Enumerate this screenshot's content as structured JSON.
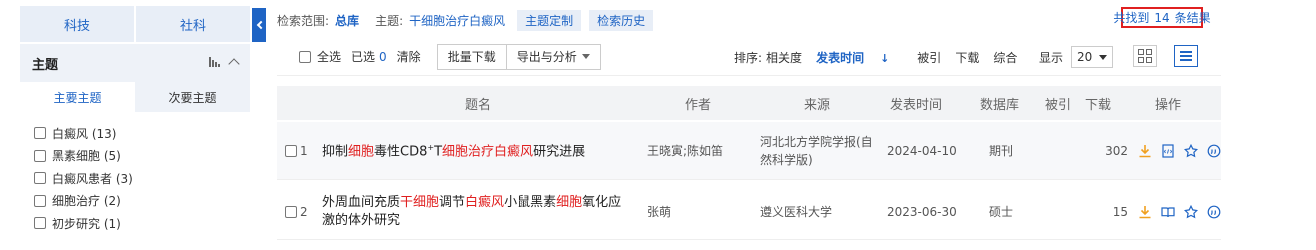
{
  "sidebar": {
    "category_tabs": [
      "科技",
      "社科"
    ],
    "topic_title": "主题",
    "sub_tabs": [
      "主要主题",
      "次要主题"
    ],
    "facets": [
      {
        "label": "白癜风 (13)"
      },
      {
        "label": "黑素细胞 (5)"
      },
      {
        "label": "白癜风患者 (3)"
      },
      {
        "label": "细胞治疗 (2)"
      },
      {
        "label": "初步研究 (1)"
      }
    ]
  },
  "scope": {
    "range_label": "检索范围:",
    "range_value": "总库",
    "topic_label": "主题:",
    "topic_value": "干细胞治疗白癜风",
    "chip_custom": "主题定制",
    "chip_history": "检索历史"
  },
  "result": {
    "prefix": "共找到",
    "count": "14",
    "suffix": "条结果"
  },
  "toolbar": {
    "select_all": "全选",
    "selected_label": "已选",
    "selected_count": "0",
    "clear": "清除",
    "batch_download": "批量下载",
    "export": "导出与分析",
    "sort_label": "排序:",
    "sort_relevance": "相关度",
    "sort_date": "发表时间",
    "sort_cited": "被引",
    "sort_download": "下载",
    "sort_composite": "综合",
    "show_label": "显示",
    "page_size": "20"
  },
  "table": {
    "headers": [
      "题名",
      "作者",
      "来源",
      "发表时间",
      "数据库",
      "被引",
      "下载",
      "操作"
    ],
    "rows": [
      {
        "index": "1",
        "title_parts": [
          "抑制",
          "细胞",
          "毒性CD8",
          "+",
          "T",
          "细胞治疗白癜风",
          "研究进展"
        ],
        "author": "王晓寅;陈如笛",
        "source": "河北北方学院学报(自然科学版)",
        "date": "2024-04-10",
        "db": "期刊",
        "cited": "",
        "downloads": "302"
      },
      {
        "index": "2",
        "title_parts": [
          "外周血间充质",
          "干细胞",
          "调节",
          "白癜风",
          "小鼠黑素",
          "细胞",
          "氧化应激的体外研究"
        ],
        "author": "张萌",
        "source": "遵义医科大学",
        "date": "2023-06-30",
        "db": "硕士",
        "cited": "",
        "downloads": "15"
      }
    ]
  },
  "colors": {
    "accent": "#1f64c4",
    "highlight": "#e02020",
    "download_icon": "#f0a020"
  },
  "icons": [
    "chevron-left-icon",
    "bar-chart-icon",
    "chevron-up-icon",
    "download-icon",
    "html-read-icon",
    "book-read-icon",
    "star-icon",
    "quote-icon",
    "grid-view-icon",
    "list-view-icon"
  ]
}
